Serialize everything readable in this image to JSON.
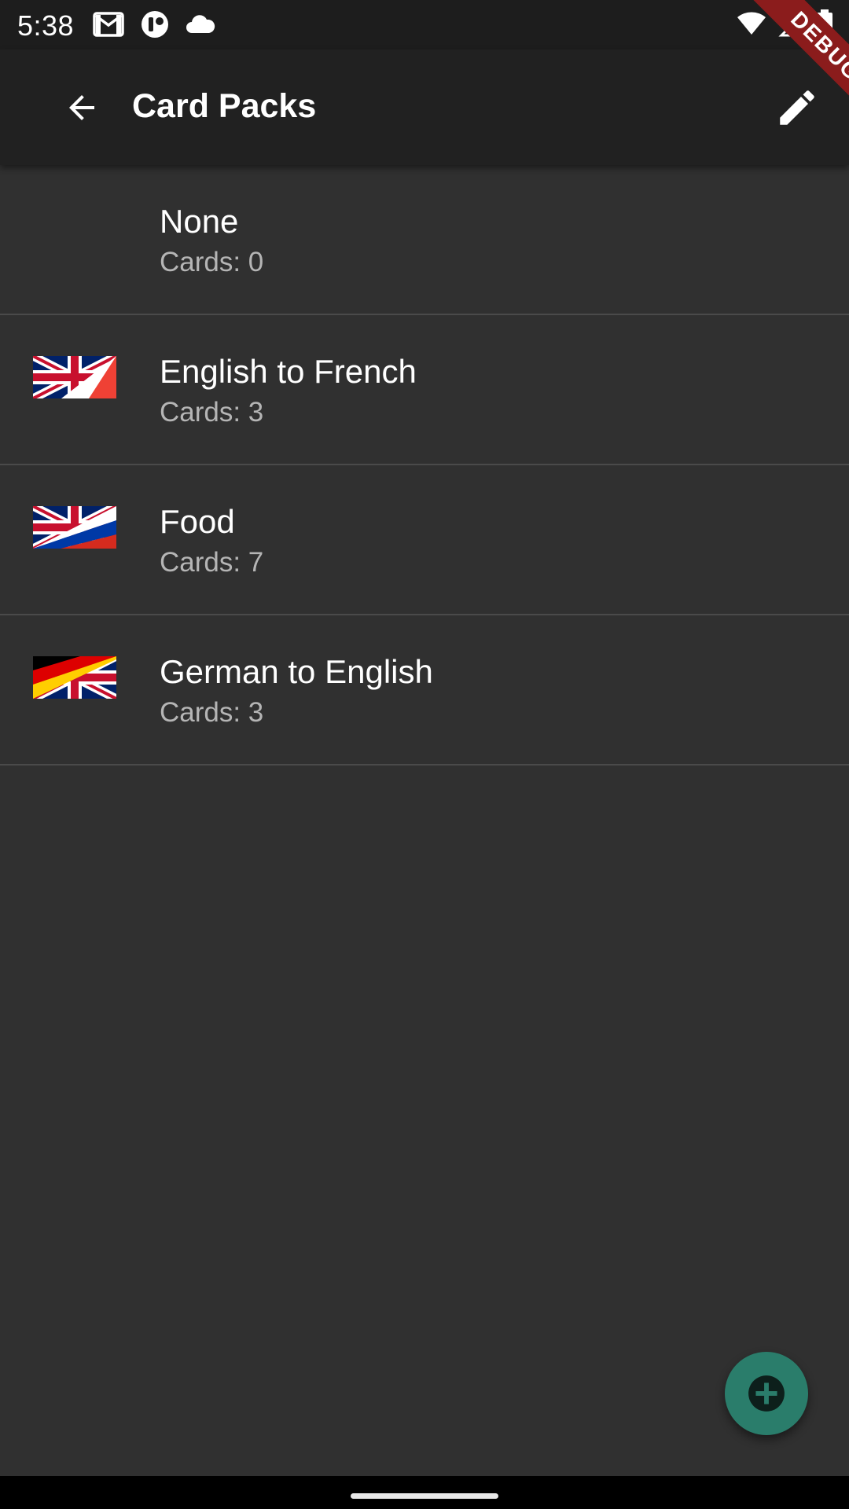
{
  "status_bar": {
    "time": "5:38",
    "left_icons": [
      "gmail-icon",
      "app-notification-icon",
      "cloud-icon"
    ],
    "right_icons": [
      "wifi-icon",
      "signal-icon",
      "battery-icon"
    ]
  },
  "app_bar": {
    "title": "Card Packs",
    "back_icon": "arrow-back-icon",
    "action_icon": "edit-pencil-icon"
  },
  "debug_banner": {
    "label": "DEBUG",
    "color": "#8b1c1c"
  },
  "packs": [
    {
      "title": "None",
      "subtitle": "Cards: 0",
      "flag": "none"
    },
    {
      "title": "English to French",
      "subtitle": "Cards: 3",
      "flag": "uk-france"
    },
    {
      "title": "Food",
      "subtitle": "Cards: 7",
      "flag": "uk-russia"
    },
    {
      "title": "German to English",
      "subtitle": "Cards: 3",
      "flag": "germany-uk"
    }
  ],
  "fab": {
    "icon": "add-circle-icon",
    "color": "#2a7d6b"
  },
  "colors": {
    "background": "#303030",
    "app_bar": "#212121",
    "status_bar": "#1d1d1d",
    "divider": "#4a4a4a",
    "subtitle": "#b5b5b5"
  }
}
